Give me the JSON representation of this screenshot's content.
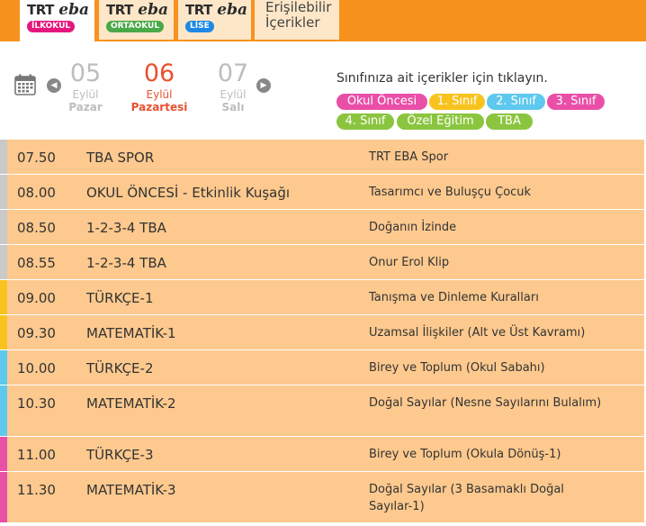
{
  "tabs": [
    {
      "brand_prefix": "TRT",
      "brand_name": "eba",
      "level": "İLKOKUL",
      "color": "#e5177e"
    },
    {
      "brand_prefix": "TRT",
      "brand_name": "eba",
      "level": "ORTAOKUL",
      "color": "#4aa848"
    },
    {
      "brand_prefix": "TRT",
      "brand_name": "eba",
      "level": "LİSE",
      "color": "#1e88e5"
    }
  ],
  "accessible_tab": {
    "line1": "Erişilebilir",
    "line2": "İçerikler"
  },
  "dates": [
    {
      "num": "05",
      "month": "Eylül",
      "dow": "Pazar"
    },
    {
      "num": "06",
      "month": "Eylül",
      "dow": "Pazartesi"
    },
    {
      "num": "07",
      "month": "Eylül",
      "dow": "Salı"
    }
  ],
  "hint": "Sınıfınıza ait içerikler için tıklayın.",
  "chips": [
    {
      "label": "Okul Öncesi",
      "color": "#ea4fa8"
    },
    {
      "label": "1. Sınıf",
      "color": "#f9c31f"
    },
    {
      "label": "2. Sınıf",
      "color": "#5ec8ee"
    },
    {
      "label": "3. Sınıf",
      "color": "#ea4fa8"
    },
    {
      "label": "4. Sınıf",
      "color": "#8bc53f"
    },
    {
      "label": "Özel Eğitim",
      "color": "#8bc53f"
    },
    {
      "label": "TBA",
      "color": "#8bc53f"
    }
  ],
  "schedule": [
    {
      "time": "07.50",
      "subject": "TBA SPOR",
      "topic": "TRT EBA Spor",
      "color": "#c9c9c9"
    },
    {
      "time": "08.00",
      "subject": "OKUL ÖNCESİ - Etkinlik Kuşağı",
      "topic": "Tasarımcı ve Buluşçu Çocuk",
      "color": "#c9c9c9"
    },
    {
      "time": "08.50",
      "subject": "1-2-3-4 TBA",
      "topic": "Doğanın İzinde",
      "color": "#c9c9c9"
    },
    {
      "time": "08.55",
      "subject": "1-2-3-4 TBA",
      "topic": "Onur Erol Klip",
      "color": "#c9c9c9"
    },
    {
      "time": "09.00",
      "subject": "TÜRKÇE-1",
      "topic": "Tanışma ve Dinleme Kuralları",
      "color": "#f9c31f"
    },
    {
      "time": "09.30",
      "subject": "MATEMATİK-1",
      "topic": "Uzamsal İlişkiler (Alt ve Üst Kavramı)",
      "color": "#f9c31f"
    },
    {
      "time": "10.00",
      "subject": "TÜRKÇE-2",
      "topic": "Birey ve Toplum (Okul Sabahı)",
      "color": "#5ec8ee"
    },
    {
      "time": "10.30",
      "subject": "MATEMATİK-2",
      "topic": "Doğal Sayılar (Nesne Sayılarını Bulalım)",
      "color": "#5ec8ee"
    },
    {
      "time": "11.00",
      "subject": "TÜRKÇE-3",
      "topic": "Birey ve Toplum (Okula Dönüş-1)",
      "color": "#ea4fa8"
    },
    {
      "time": "11.30",
      "subject": "MATEMATİK-3",
      "topic": "Doğal Sayılar (3 Basamaklı Doğal Sayılar-1)",
      "color": "#ea4fa8"
    }
  ]
}
